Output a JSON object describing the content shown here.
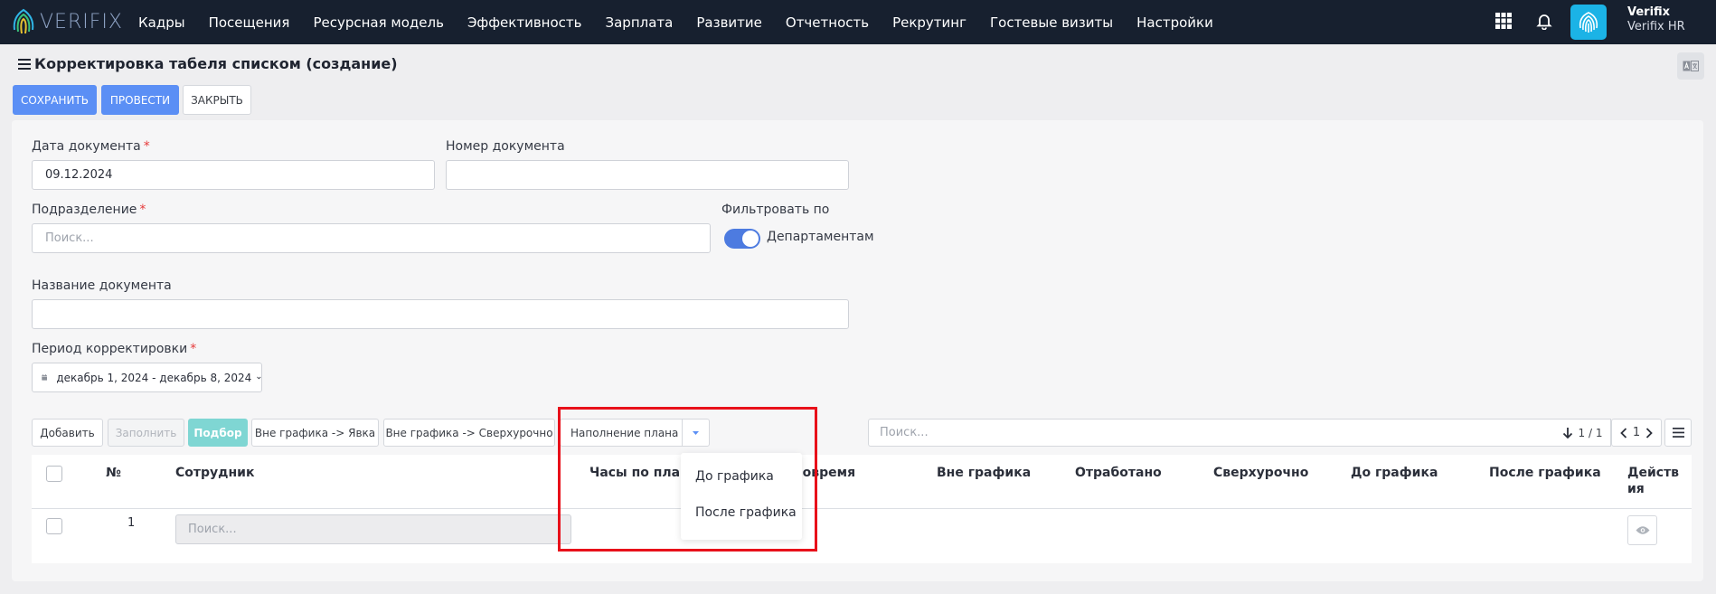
{
  "topbar": {
    "logo_text": "VERIFIX",
    "nav": [
      "Кадры",
      "Посещения",
      "Ресурсная модель",
      "Эффективность",
      "Зарплата",
      "Развитие",
      "Отчетность",
      "Рекрутинг",
      "Гостевые визиты",
      "Настройки"
    ],
    "user_name": "Verifix",
    "user_org": "Verifix HR",
    "icons": [
      "apps-grid-icon",
      "bell-icon",
      "fingerprint-icon"
    ]
  },
  "page": {
    "title": "Корректировка табеля списком (создание)",
    "buttons": {
      "save": "СОХРАНИТЬ",
      "post": "ПРОВЕСТИ",
      "close": "ЗАКРЫТЬ"
    }
  },
  "form": {
    "doc_date_label": "Дата документа",
    "doc_date_value": "09.12.2024",
    "doc_number_label": "Номер документа",
    "doc_number_value": "",
    "division_label": "Подразделение",
    "division_placeholder": "Поиск...",
    "filter_label": "Фильтровать по",
    "filter_toggle_label": "Департаментам",
    "filter_toggle_on": true,
    "doc_name_label": "Название документа",
    "doc_name_value": "",
    "period_label": "Период корректировки",
    "period_value": "декабрь 1, 2024 - декабрь 8, 2024",
    "required_mark": "*"
  },
  "toolbar": {
    "add": "Добавить",
    "fill": "Заполнить",
    "pick": "Подбор",
    "out_to_attendance": "Вне графика -> Явка",
    "out_to_overtime": "Вне графика -> Сверхурочно",
    "plan_fill": "Наполнение плана",
    "search_placeholder": "Поиск...",
    "page_info": "1 / 1",
    "page_number": "1"
  },
  "dropdown": {
    "items": [
      "До графика",
      "После графика"
    ]
  },
  "table": {
    "headers": [
      "№",
      "Сотрудник",
      "Часы по плану",
      "Вовремя",
      "Вне графика",
      "Отработано",
      "Сверхурочно",
      "До графика",
      "После графика",
      "Действ\nия"
    ],
    "rows": [
      {
        "num": "1",
        "employee_placeholder": "Поиск..."
      }
    ]
  },
  "colors": {
    "topbar": "#17202f",
    "primary": "#5b8ff5",
    "teal": "#7fd6d3",
    "highlight": "#e8101a"
  }
}
